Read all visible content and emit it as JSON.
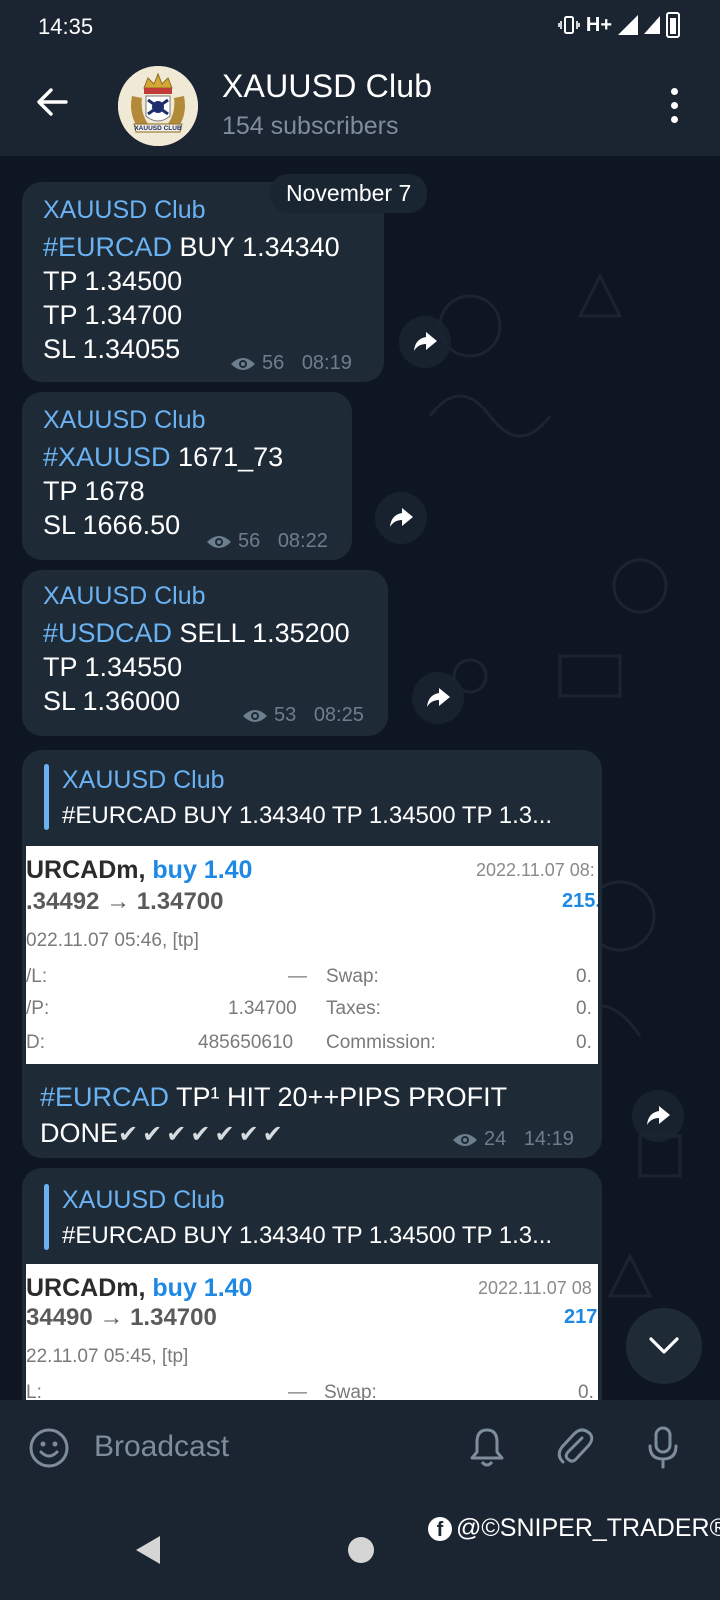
{
  "status_bar": {
    "time": "14:35",
    "network": "H+"
  },
  "header": {
    "title": "XAUUSD Club",
    "subtitle": "154 subscribers",
    "avatar_text": "XAUUSD CLUB"
  },
  "date_pill": "November 7",
  "messages": [
    {
      "sender": "XAUUSD Club",
      "hashtag": "#EURCAD",
      "line1_rest": " BUY 1.34340",
      "lines": [
        "TP 1.34500",
        "TP 1.34700",
        "SL 1.34055"
      ],
      "views": "56",
      "time": "08:19"
    },
    {
      "sender": "XAUUSD Club",
      "hashtag": "#XAUUSD",
      "line1_rest": " 1671_73",
      "lines": [
        "TP 1678",
        "SL 1666.50"
      ],
      "views": "56",
      "time": "08:22"
    },
    {
      "sender": "XAUUSD Club",
      "hashtag": "#USDCAD",
      "line1_rest": " SELL 1.35200",
      "lines": [
        "TP 1.34550",
        "SL 1.36000"
      ],
      "views": "53",
      "time": "08:25"
    }
  ],
  "reply_posts": [
    {
      "quote_name": "XAUUSD Club",
      "quote_text": "#EURCAD BUY 1.34340 TP 1.34500 TP 1.3...",
      "shot": {
        "symbol": "URCADm,",
        "side": "buy 1.40",
        "datetime": "2022.11.07 08:",
        "prices": ".34492 → 1.34700",
        "profit": "215.",
        "open": "022.11.07 05:46, [tp]",
        "rows": [
          {
            "l": "/L:",
            "v": "—",
            "k": "Swap:",
            "kv": "0."
          },
          {
            "l": "/P:",
            "v": "1.34700",
            "k": "Taxes:",
            "kv": "0."
          },
          {
            "l": "D:",
            "v": "485650610",
            "k": "Commission:",
            "kv": "0."
          }
        ]
      },
      "hashtag": "#EURCAD",
      "caption_rest": " TP¹ HIT 20++PIPS  PROFIT",
      "caption_line2": "DONE",
      "checks": "✔✔✔✔✔✔✔",
      "views": "24",
      "time": "14:19"
    },
    {
      "quote_name": "XAUUSD Club",
      "quote_text": "#EURCAD BUY 1.34340 TP 1.34500 TP 1.3...",
      "shot": {
        "symbol": "URCADm,",
        "side": "buy 1.40",
        "datetime": "2022.11.07 08",
        "prices": "34490 → 1.34700",
        "profit": "217.",
        "open": "22.11.07 05:45, [tp]",
        "rows": [
          {
            "l": "L:",
            "v": "—",
            "k": "Swap:",
            "kv": "0."
          }
        ]
      }
    }
  ],
  "input": {
    "placeholder": "Broadcast"
  },
  "watermark": "@©SNIPER_TRADER®",
  "colors": {
    "background": "#0e1621",
    "bubble": "#1e2a36",
    "accent": "#6ab2f2",
    "header": "#1b2531"
  }
}
